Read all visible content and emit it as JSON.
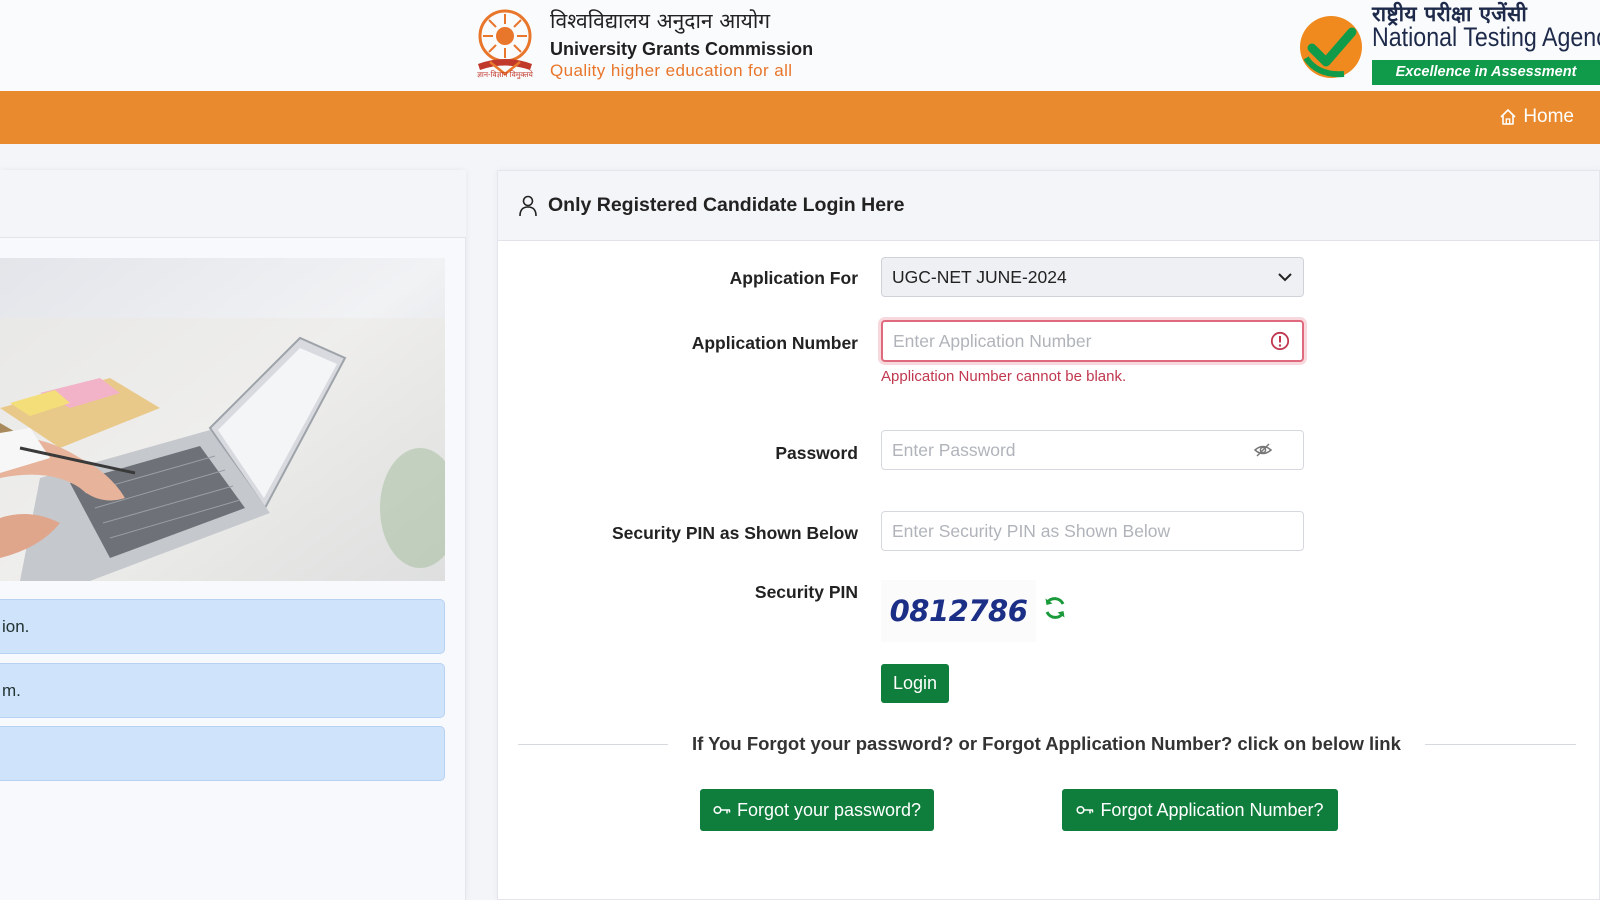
{
  "header": {
    "ugc": {
      "hindi_name": "विश्वविद्यालय अनुदान आयोग",
      "name": "University Grants Commission",
      "tagline": "Quality higher education for all",
      "emblem_caption": "ज्ञान-विज्ञान विमुक्तये"
    },
    "nta": {
      "hindi_name": "राष्ट्रीय परीक्षा एजेंसी",
      "name": "National Testing Agency",
      "tagline": "Excellence in Assessment"
    }
  },
  "nav": {
    "home_label": "Home"
  },
  "left_panel": {
    "items": [
      "ion.",
      "m.",
      ""
    ]
  },
  "login": {
    "title": "Only Registered Candidate Login Here",
    "application_for_label": "Application For",
    "application_for_value": "UGC-NET JUNE-2024",
    "application_number_label": "Application Number",
    "application_number_placeholder": "Enter Application Number",
    "application_number_error": "Application Number cannot be blank.",
    "password_label": "Password",
    "password_placeholder": "Enter Password",
    "security_pin_input_label": "Security PIN as Shown Below",
    "security_pin_input_placeholder": "Enter Security PIN as Shown Below",
    "security_pin_label": "Security PIN",
    "security_pin_value": "0812786",
    "login_button": "Login",
    "forgot_text": "If You Forgot your password? or Forgot Application Number? click on below link",
    "forgot_password_button": "Forgot your password?",
    "forgot_app_number_button": "Forgot Application Number?"
  },
  "colors": {
    "navbar": "#e98a2f",
    "green_button": "#0f7d3b",
    "error": "#c0384e",
    "captcha": "#1c2f86",
    "nta_green": "#0f9b4a"
  }
}
